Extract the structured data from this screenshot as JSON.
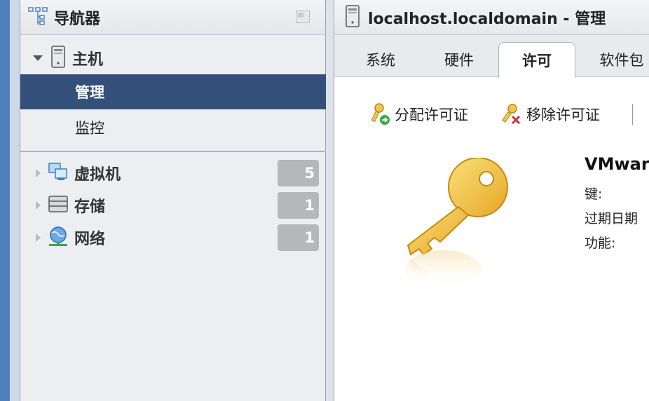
{
  "navigator": {
    "title": "导航器",
    "host": {
      "label": "主机",
      "items": [
        {
          "label": "管理",
          "selected": true
        },
        {
          "label": "监控",
          "selected": false
        }
      ]
    },
    "tree": [
      {
        "label": "虚拟机",
        "count": "5",
        "icon": "vm-icon"
      },
      {
        "label": "存储",
        "count": "1",
        "icon": "storage-icon"
      },
      {
        "label": "网络",
        "count": "1",
        "icon": "network-icon"
      }
    ]
  },
  "main": {
    "title": "localhost.localdomain - 管理",
    "tabs": [
      {
        "label": "系统"
      },
      {
        "label": "硬件"
      },
      {
        "label": "许可",
        "active": true
      },
      {
        "label": "软件包"
      }
    ],
    "toolbar": {
      "assign_label": "分配许可证",
      "remove_label": "移除许可证"
    },
    "license": {
      "product": "VMwar",
      "key_label": "键:",
      "expiry_label": "过期日期",
      "features_label": "功能:"
    }
  },
  "colors": {
    "selected_bg": "#32507a",
    "accent_strip": "#4e80bd",
    "badge_bg": "#b5b8bb"
  }
}
